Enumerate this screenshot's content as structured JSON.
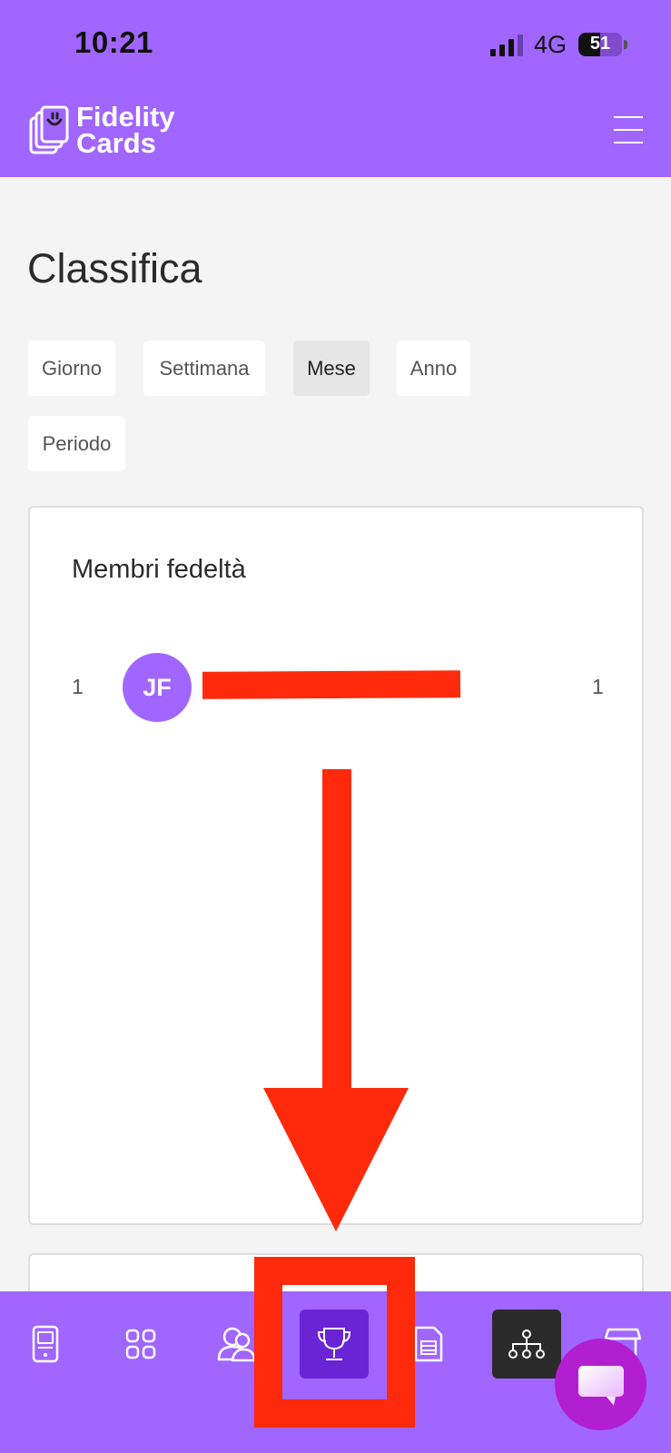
{
  "status_bar": {
    "time": "10:21",
    "network": "4G",
    "battery": "51",
    "battery_level": 0.51
  },
  "app_bar": {
    "logo_line1": "Fidelity",
    "logo_line2": "Cards",
    "menu_icon": "hamburger-menu-icon"
  },
  "page": {
    "title": "Classifica"
  },
  "tabs": [
    {
      "label": "Giorno",
      "active": false
    },
    {
      "label": "Settimana",
      "active": false
    },
    {
      "label": "Mese",
      "active": true
    },
    {
      "label": "Anno",
      "active": false
    },
    {
      "label": "Periodo",
      "active": false
    }
  ],
  "leaderboard": {
    "title": "Membri fedeltà",
    "rows": [
      {
        "rank": "1",
        "initials": "JF",
        "score": "1"
      }
    ]
  },
  "bottom_nav": [
    {
      "icon": "phone-card-icon",
      "active": false
    },
    {
      "icon": "grid-icon",
      "active": false
    },
    {
      "icon": "users-icon",
      "active": false
    },
    {
      "icon": "trophy-icon",
      "active": true
    },
    {
      "icon": "document-list-icon",
      "active": false
    },
    {
      "icon": "hierarchy-icon",
      "active": false,
      "dark": true
    },
    {
      "icon": "store-icon",
      "active": false
    }
  ],
  "colors": {
    "brand_purple": "#a066ff",
    "active_tab": "#6a24d6",
    "annotation_red": "#ff2a0b",
    "chat_fab": "#b21fd0"
  }
}
